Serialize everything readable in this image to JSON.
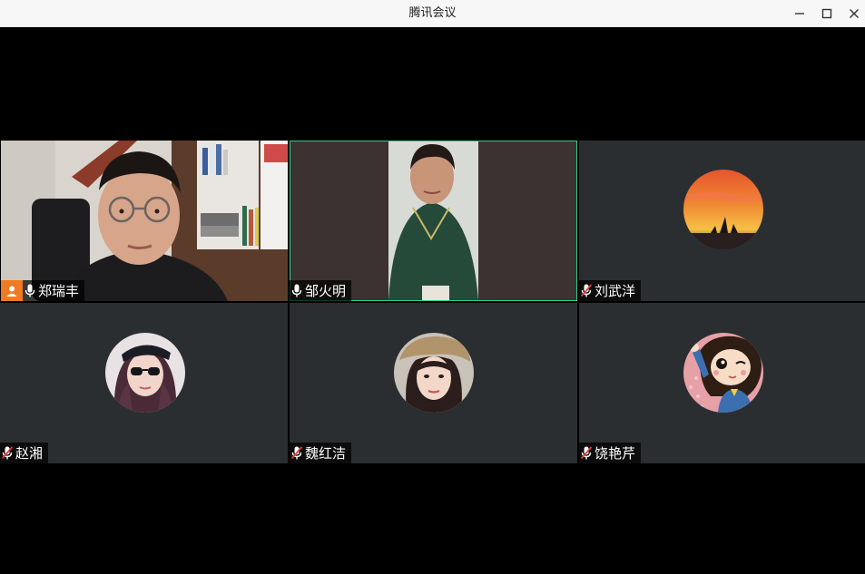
{
  "window": {
    "title": "腾讯会议"
  },
  "participants": [
    {
      "name": "郑瑞丰",
      "mic": "on",
      "host": true,
      "video": "on"
    },
    {
      "name": "邹火明",
      "mic": "on",
      "host": false,
      "video": "on",
      "speaking": true
    },
    {
      "name": "刘武洋",
      "mic": "muted",
      "host": false,
      "video": "off",
      "avatar": "sunset-sailboat-avatar"
    },
    {
      "name": "赵湘",
      "mic": "muted",
      "host": false,
      "video": "off",
      "avatar": "girl-sunglasses-avatar"
    },
    {
      "name": "魏红洁",
      "mic": "muted",
      "host": false,
      "video": "off",
      "avatar": "girl-beret-avatar"
    },
    {
      "name": "饶艳芹",
      "mic": "muted",
      "host": false,
      "video": "off",
      "avatar": "cartoon-girl-avatar"
    }
  ],
  "colors": {
    "host_badge": "#f07b22",
    "active_speaker_border": "#2fd08b",
    "tile_bg": "#2b2e31",
    "muted_mic": "#e03a3a"
  }
}
